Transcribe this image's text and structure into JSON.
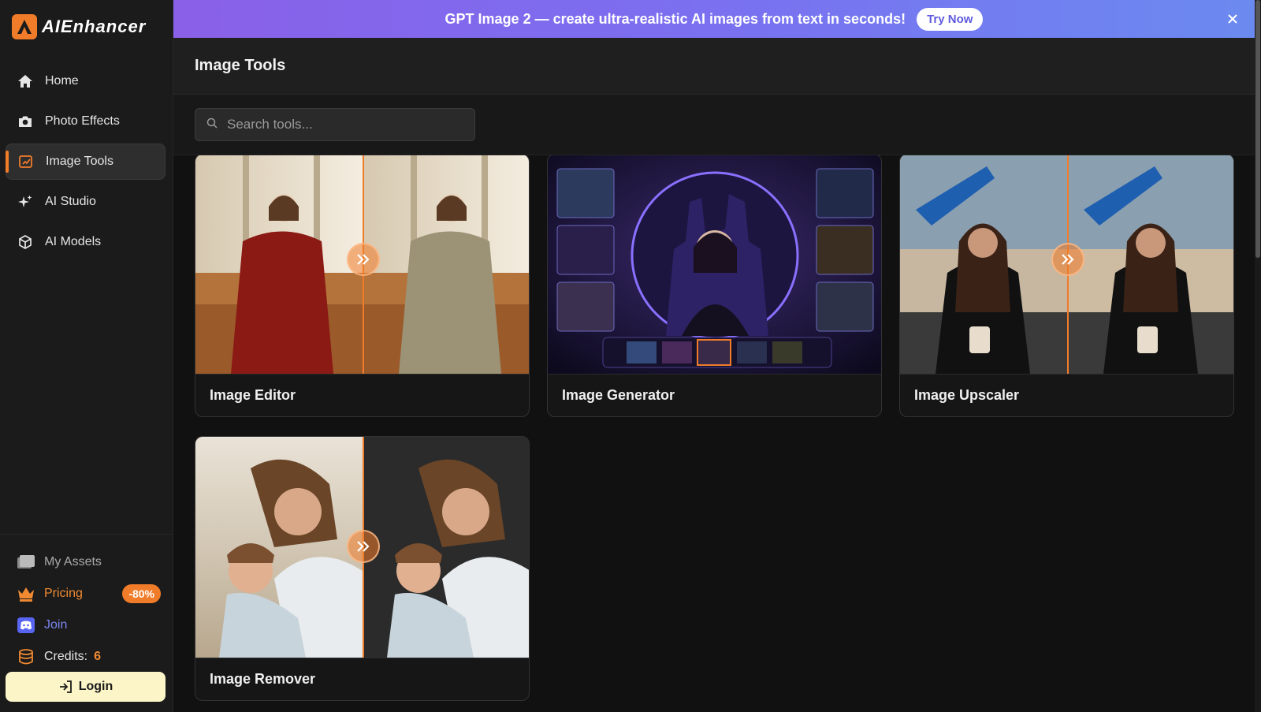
{
  "app": {
    "name": "AIEnhancer"
  },
  "sidebar": {
    "items": [
      {
        "label": "Home",
        "icon": "home-icon"
      },
      {
        "label": "Photo Effects",
        "icon": "camera-icon"
      },
      {
        "label": "Image Tools",
        "icon": "edit-image-icon",
        "active": true
      },
      {
        "label": "AI Studio",
        "icon": "sparkles-icon"
      },
      {
        "label": "AI Models",
        "icon": "cube-icon"
      }
    ],
    "bottom": {
      "assets": "My Assets",
      "pricing": "Pricing",
      "pricing_badge": "-80%",
      "join": "Join",
      "credits_label": "Credits:",
      "credits_value": "6"
    },
    "login": "Login"
  },
  "banner": {
    "text": "GPT Image 2 — create ultra-realistic AI images from text in seconds!",
    "button": "Try Now"
  },
  "header": {
    "title": "Image Tools"
  },
  "search": {
    "placeholder": "Search tools..."
  },
  "tools": [
    {
      "label": "Image Editor"
    },
    {
      "label": "Image Generator"
    },
    {
      "label": "Image Upscaler"
    },
    {
      "label": "Image Remover"
    }
  ],
  "colors": {
    "accent": "#f07c2a",
    "discord": "#7b86f0",
    "login_bg": "#fbf5c7"
  }
}
